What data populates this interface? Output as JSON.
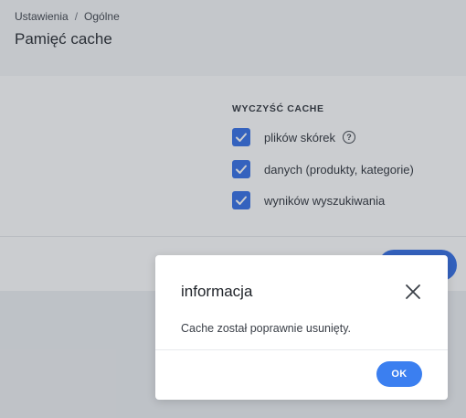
{
  "header": {
    "breadcrumb": [
      "Ustawienia",
      "Ogólne"
    ],
    "breadcrumb_separator": "/",
    "title": "Pamięć cache"
  },
  "cache": {
    "section_title": "WYCZYŚĆ CACHE",
    "options": [
      {
        "label": "plików skórek",
        "checked": true,
        "help_icon": "question-circle-icon"
      },
      {
        "label": "danych (produkty, kategorie)",
        "checked": true
      },
      {
        "label": "wyników wyszukiwania",
        "checked": true
      }
    ]
  },
  "dialog": {
    "title": "informacja",
    "message": "Cache został poprawnie usunięty.",
    "ok_label": "OK",
    "close_icon": "close-icon"
  },
  "colors": {
    "accent": "#2e6be6",
    "ok_button": "#3b7ff0"
  }
}
